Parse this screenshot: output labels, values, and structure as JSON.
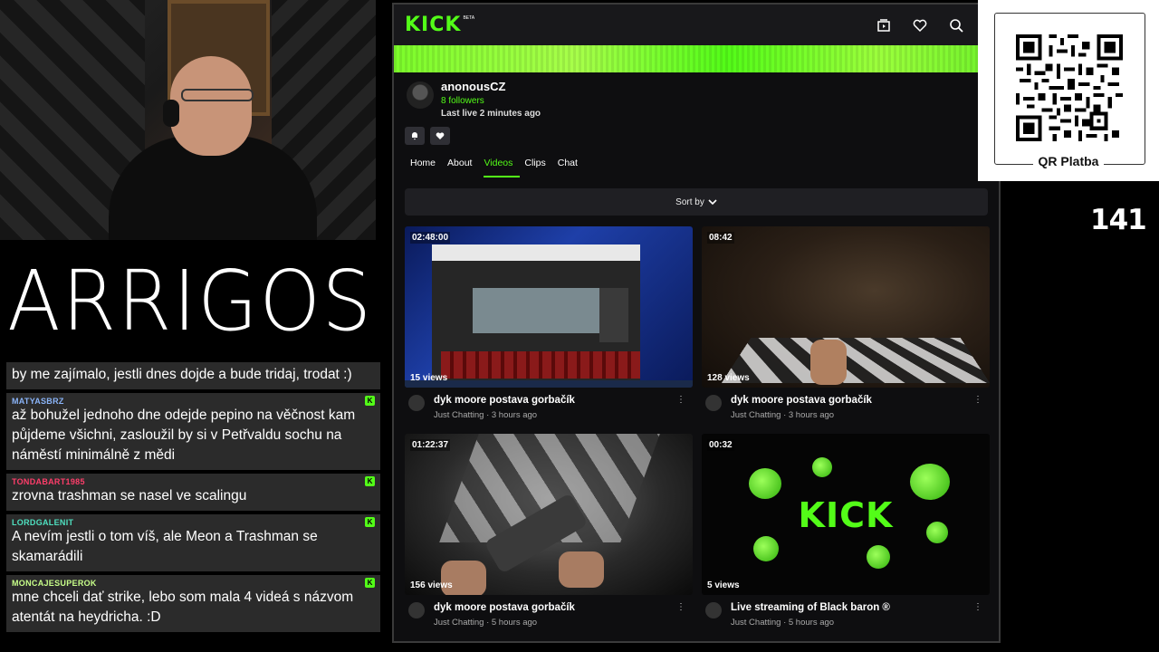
{
  "stream": {
    "logo_text": "ARRIGOS",
    "counter": "141",
    "qr_label": "QR Platba"
  },
  "chat": {
    "messages": [
      {
        "user": "",
        "user_color": "#ffffff",
        "text": "by me zajímalo, jestli dnes dojde a bude tridaj, trodat :)",
        "badge": false
      },
      {
        "user": "MATYASBRZ",
        "user_color": "#8ab4f8",
        "text": "až bohužel jednoho dne odejde pepino na věčnost kam půjdeme všichni, zasloužil by si v Petřvaldu sochu na náměstí minimálně z mědi",
        "badge": true
      },
      {
        "user": "TONDABART1985",
        "user_color": "#ff3d6a",
        "text": "zrovna trashman se nasel ve scalingu",
        "badge": true
      },
      {
        "user": "LORDGALENIT",
        "user_color": "#4fe0c0",
        "text": "A nevím jestli o tom víš, ale Meon a Trashman se skamarádili",
        "badge": true
      },
      {
        "user": "MONCAJESUPEROK",
        "user_color": "#c8ff8a",
        "text": "mne chceli dať strike, lebo som mala 4 videá s názvom atentát na heydricha. :D",
        "badge": true
      }
    ]
  },
  "browser": {
    "brand": "KICK",
    "brand_tag": "BETA",
    "brand_color": "#53fc18",
    "icons": [
      "browse-icon",
      "heart-icon",
      "search-icon",
      "avatar"
    ],
    "channel": {
      "name": "anonousCZ",
      "followers": "8 followers",
      "last_live": "Last live 2 minutes ago",
      "tabs": [
        "Home",
        "About",
        "Videos",
        "Clips",
        "Chat"
      ],
      "active_tab": "Videos"
    },
    "sort_label": "Sort by",
    "videos": [
      {
        "duration": "02:48:00",
        "views": "15 views",
        "title": "dyk moore postava gorbačík",
        "meta": "Just Chatting · 3 hours ago"
      },
      {
        "duration": "08:42",
        "views": "128 views",
        "title": "dyk moore postava gorbačík",
        "meta": "Just Chatting · 3 hours ago"
      },
      {
        "duration": "01:22:37",
        "views": "156 views",
        "title": "dyk moore postava gorbačík",
        "meta": "Just Chatting · 5 hours ago"
      },
      {
        "duration": "00:32",
        "views": "5 views",
        "title": "Live streaming of Black baron ®",
        "meta": "Just Chatting · 5 hours ago",
        "thumb_text": "KICK"
      }
    ]
  }
}
